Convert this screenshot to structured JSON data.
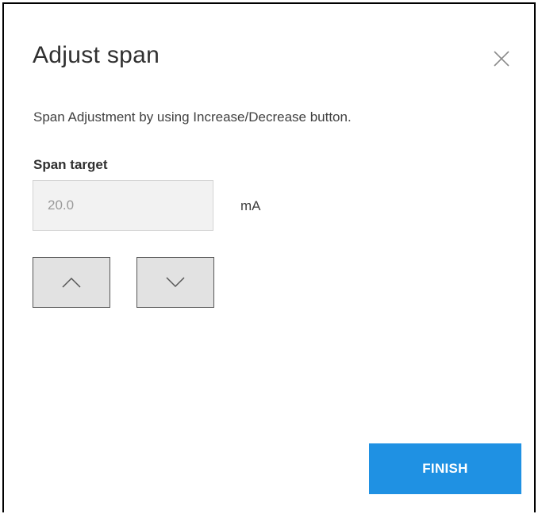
{
  "dialog": {
    "title": "Adjust span",
    "close_icon": "close-icon",
    "description": "Span Adjustment by using Increase/Decrease button.",
    "span_target": {
      "label": "Span target",
      "value": "20.0",
      "unit": "mA"
    },
    "increase_icon": "chevron-up-icon",
    "decrease_icon": "chevron-down-icon",
    "finish_label": "FINISH"
  },
  "colors": {
    "primary": "#1f91e3",
    "input_background": "#f2f2f2",
    "step_button_background": "#e2e2e2"
  }
}
